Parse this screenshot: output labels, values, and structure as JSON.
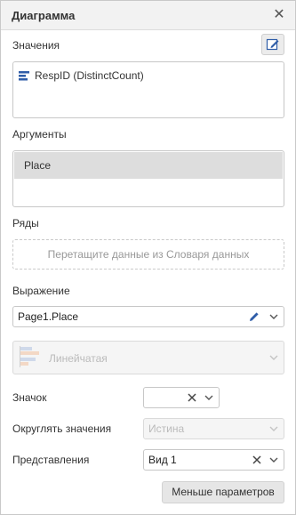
{
  "dialog": {
    "title": "Диаграмма"
  },
  "values": {
    "label": "Значения",
    "items": [
      {
        "label": "RespID (DistinctCount)",
        "icon": "bar-chart-icon"
      }
    ]
  },
  "arguments": {
    "label": "Аргументы",
    "items": [
      {
        "label": "Place"
      }
    ]
  },
  "series": {
    "label": "Ряды",
    "placeholder": "Перетащите данные из Словаря данных"
  },
  "expression": {
    "label": "Выражение",
    "value": "Page1.Place"
  },
  "chart_type": {
    "value": "Линейчатая"
  },
  "marker": {
    "label": "Значок",
    "value": ""
  },
  "round_values": {
    "label": "Округлять значения",
    "value": "Истина"
  },
  "views": {
    "label": "Представления",
    "value": "Вид 1"
  },
  "less_params_button": "Меньше параметров",
  "colors": {
    "accent": "#2f5da8",
    "titlebar": "#f2f2f2",
    "button": "#e6e6e6"
  }
}
